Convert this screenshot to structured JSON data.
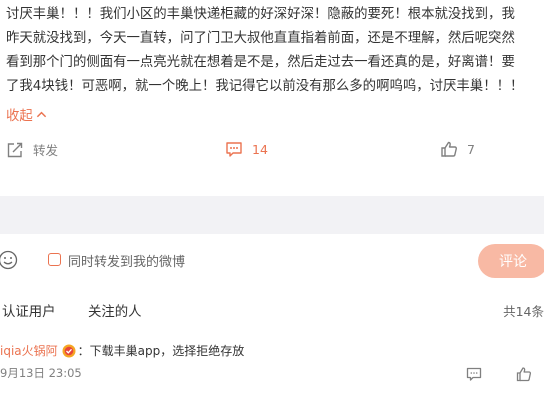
{
  "post": {
    "lines": [
      "讨厌丰巢！！！我们小区的丰巢快递柜藏的好深好深！隐蔽的要死！根本就没找到，我",
      "昨天就没找到，今天一直转，问了门卫大叔他直直指着前面，还是不理解，然后呢突然",
      "看到那个门的侧面有一点亮光就在想着是不是，然后走过去一看还真的是，好离谱！要",
      "了我4块钱！可恶啊，就一个晚上！我记得它以前没有那么多的啊呜呜，讨厌丰巢！！！"
    ],
    "collapse_label": "收起"
  },
  "actions": {
    "repost_label": "转发",
    "comment_count": "14",
    "like_count": "7"
  },
  "composer": {
    "checkbox_label": "同时转发到我的微博",
    "submit_label": "评论"
  },
  "tabs": {
    "tab1": "认证用户",
    "tab2": "关注的人",
    "total": "共14条"
  },
  "comment": {
    "user": "iqia火锅阿",
    "text": "：下载丰巢app，选择拒绝存放",
    "time": "9月13日 23:05"
  },
  "colors": {
    "accent": "#eb7350",
    "submit_disabled": "#f8b9a4",
    "band": "#f2f2f5",
    "muted": "#808080"
  }
}
